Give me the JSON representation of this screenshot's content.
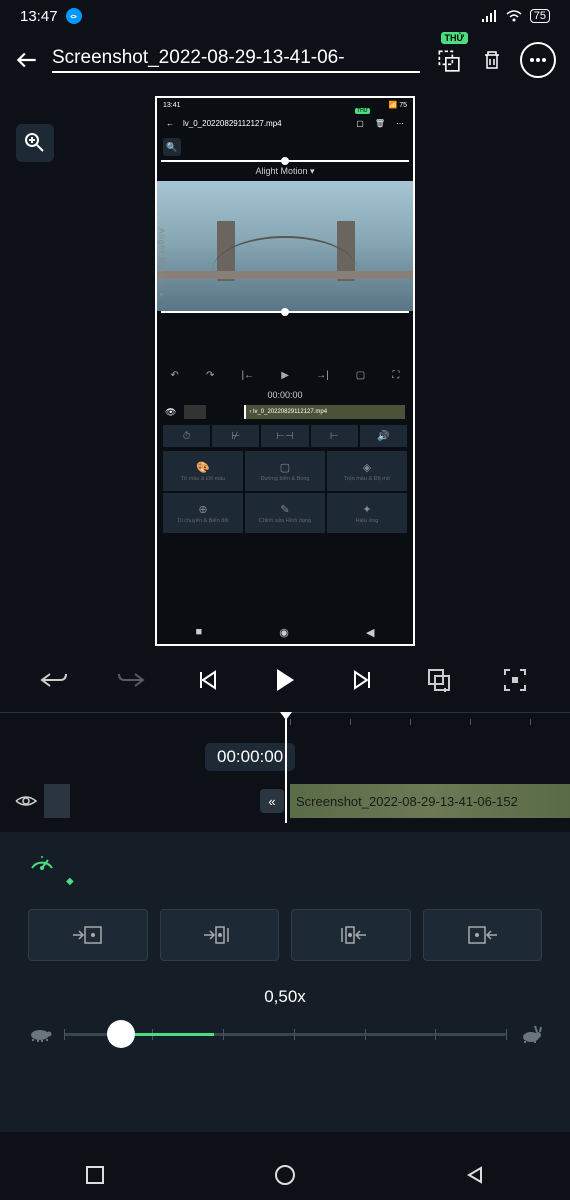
{
  "status": {
    "time": "13:47",
    "battery": "75"
  },
  "toolbar": {
    "filename": "Screenshot_2022-08-29-13-41-06-",
    "thu_badge": "THỬ"
  },
  "preview": {
    "inner_time": "13:41",
    "inner_filename": "lv_0_20220829112127.mp4",
    "inner_thu": "THỬ",
    "alight_motion": "Alight Motion ▾",
    "watermark": "Alight Motion ▾",
    "inner_timestamp": "00:00:00",
    "inner_clip": "lv_0_20220829112127.mp4",
    "panel1": "Tô màu & Đổ màu",
    "panel2": "Đường biên & Bóng",
    "panel3": "Trộn màu & Độ mờ",
    "panel4": "Di chuyển & Biến đổi",
    "panel5": "Chỉnh sửa Hình dạng",
    "panel6": "Hiệu ứng"
  },
  "timeline": {
    "timestamp": "00:00:00",
    "clip_name": "Screenshot_2022-08-29-13-41-06-152"
  },
  "speed": {
    "value_label": "0,50x"
  }
}
